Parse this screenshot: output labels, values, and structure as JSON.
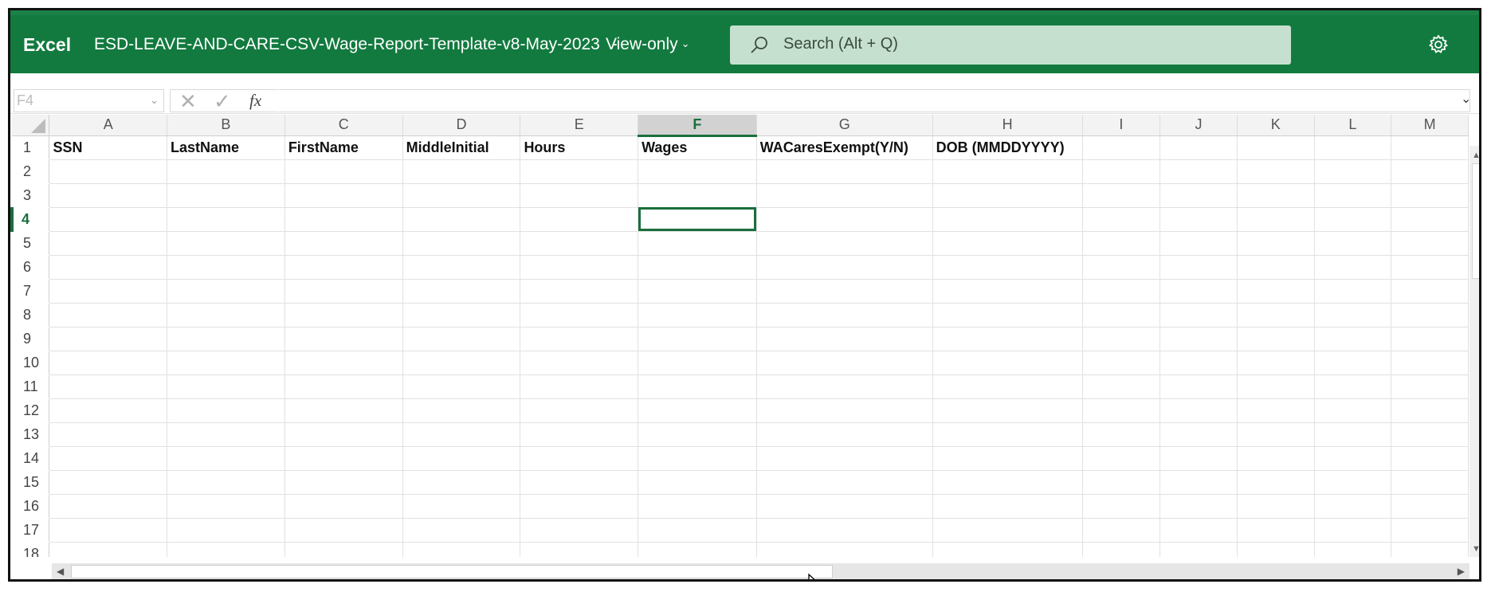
{
  "header": {
    "app_name": "Excel",
    "doc_title": "ESD-LEAVE-AND-CARE-CSV-Wage-Report-Template-v8-May-2023",
    "separator": "-",
    "view_mode": "View-only",
    "search_placeholder": "Search (Alt + Q)",
    "bg_color": "#127a3f"
  },
  "formula_bar": {
    "name_box": "F4",
    "cancel_glyph": "✕",
    "enter_glyph": "✓",
    "fx_label": "fx",
    "formula_value": ""
  },
  "columns": [
    "A",
    "B",
    "C",
    "D",
    "E",
    "F",
    "G",
    "H",
    "I",
    "J",
    "K",
    "L",
    "M"
  ],
  "active_cell": {
    "column": "F",
    "row": "4"
  },
  "rows": [
    {
      "num": "1",
      "cells": [
        "SSN",
        "LastName",
        "FirstName",
        "MiddleInitial",
        "Hours",
        "Wages",
        "WACaresExempt(Y/N)",
        "DOB (MMDDYYYY)",
        "",
        "",
        "",
        "",
        ""
      ]
    },
    {
      "num": "2",
      "cells": [
        "",
        "",
        "",
        "",
        "",
        "",
        "",
        "",
        "",
        "",
        "",
        "",
        ""
      ]
    },
    {
      "num": "3",
      "cells": [
        "",
        "",
        "",
        "",
        "",
        "",
        "",
        "",
        "",
        "",
        "",
        "",
        ""
      ]
    },
    {
      "num": "4",
      "cells": [
        "",
        "",
        "",
        "",
        "",
        "",
        "",
        "",
        "",
        "",
        "",
        "",
        ""
      ]
    },
    {
      "num": "5",
      "cells": [
        "",
        "",
        "",
        "",
        "",
        "",
        "",
        "",
        "",
        "",
        "",
        "",
        ""
      ]
    },
    {
      "num": "6",
      "cells": [
        "",
        "",
        "",
        "",
        "",
        "",
        "",
        "",
        "",
        "",
        "",
        "",
        ""
      ]
    },
    {
      "num": "7",
      "cells": [
        "",
        "",
        "",
        "",
        "",
        "",
        "",
        "",
        "",
        "",
        "",
        "",
        ""
      ]
    },
    {
      "num": "8",
      "cells": [
        "",
        "",
        "",
        "",
        "",
        "",
        "",
        "",
        "",
        "",
        "",
        "",
        ""
      ]
    },
    {
      "num": "9",
      "cells": [
        "",
        "",
        "",
        "",
        "",
        "",
        "",
        "",
        "",
        "",
        "",
        "",
        ""
      ]
    },
    {
      "num": "10",
      "cells": [
        "",
        "",
        "",
        "",
        "",
        "",
        "",
        "",
        "",
        "",
        "",
        "",
        ""
      ]
    },
    {
      "num": "11",
      "cells": [
        "",
        "",
        "",
        "",
        "",
        "",
        "",
        "",
        "",
        "",
        "",
        "",
        ""
      ]
    },
    {
      "num": "12",
      "cells": [
        "",
        "",
        "",
        "",
        "",
        "",
        "",
        "",
        "",
        "",
        "",
        "",
        ""
      ]
    },
    {
      "num": "13",
      "cells": [
        "",
        "",
        "",
        "",
        "",
        "",
        "",
        "",
        "",
        "",
        "",
        "",
        ""
      ]
    },
    {
      "num": "14",
      "cells": [
        "",
        "",
        "",
        "",
        "",
        "",
        "",
        "",
        "",
        "",
        "",
        "",
        ""
      ]
    },
    {
      "num": "15",
      "cells": [
        "",
        "",
        "",
        "",
        "",
        "",
        "",
        "",
        "",
        "",
        "",
        "",
        ""
      ]
    },
    {
      "num": "16",
      "cells": [
        "",
        "",
        "",
        "",
        "",
        "",
        "",
        "",
        "",
        "",
        "",
        "",
        ""
      ]
    },
    {
      "num": "17",
      "cells": [
        "",
        "",
        "",
        "",
        "",
        "",
        "",
        "",
        "",
        "",
        "",
        "",
        ""
      ]
    },
    {
      "num": "18",
      "cells": [
        "",
        "",
        "",
        "",
        "",
        "",
        "",
        "",
        "",
        "",
        "",
        "",
        ""
      ]
    }
  ],
  "icons": {
    "search": "search-icon",
    "settings": "gear-icon",
    "view_mode_chevron": "chevron-down-icon",
    "formula_expand": "chevron-down-icon"
  }
}
